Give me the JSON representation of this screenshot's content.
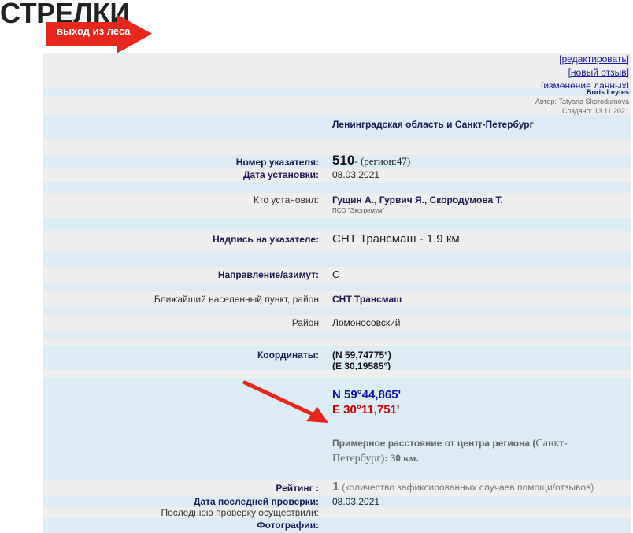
{
  "logo": {
    "title": "СТРЕЛКИ",
    "subtitle": "выход из леса"
  },
  "links": {
    "edit": "[редактировать]",
    "new_review": "[новый отзыв]",
    "change_data": "[изменение данных]"
  },
  "meta": {
    "user": "Boris Leytes",
    "author": "Автор: Tatyana Skorodumova",
    "created": "Создано: 13.11.2021"
  },
  "region_title": "Ленинградская область и Санкт-Петербург",
  "fields": {
    "number_label": "Номер указателя:",
    "number_value": "510",
    "number_region": "- (регион:47)",
    "date_label": "Дата установки:",
    "date_value": "08.03.2021",
    "installer_label": "Кто установил:",
    "installer_value": "Гущин А., Гурвич Я., Скородумова Т.",
    "installer_org": "ПСО \"Экстремум\"",
    "inscription_label": "Надпись на указателе:",
    "inscription_value": "СНТ Трансмаш - 1.9 км",
    "direction_label": "Направление/азимут:",
    "direction_value": "С",
    "nearest_label": "Ближайший населенный пункт, район",
    "nearest_value": "СНТ Трансмаш",
    "district_label": "Район",
    "district_value": "Ломоносовский",
    "coords_label": "Координаты:",
    "coords_dec_n": "(N 59,74775°)",
    "coords_dec_e": "(E 30,19585°)",
    "coords_n": "N 59°44,865'",
    "coords_e": "E 30°11,751'",
    "distance_prefix": "Примерное расстояние от центра региона (",
    "distance_city": "Санкт-Петербург",
    "distance_suffix": "): 30 км.",
    "rating_label": "Рейтинг :",
    "rating_value": "1",
    "rating_note": "(количество зафиксированных случаев помощи/отзывов)",
    "last_check_label": "Дата последней проверки:",
    "last_check_value": "08.03.2021",
    "checked_by_label": "Последнюю проверку осуществили:",
    "photos_label": "Фотографии:"
  },
  "colors": {
    "accent_red": "#e8271c",
    "row_gray": "#eeeeee",
    "row_blue": "#dcecf5",
    "label_navy": "#1a1a55"
  }
}
